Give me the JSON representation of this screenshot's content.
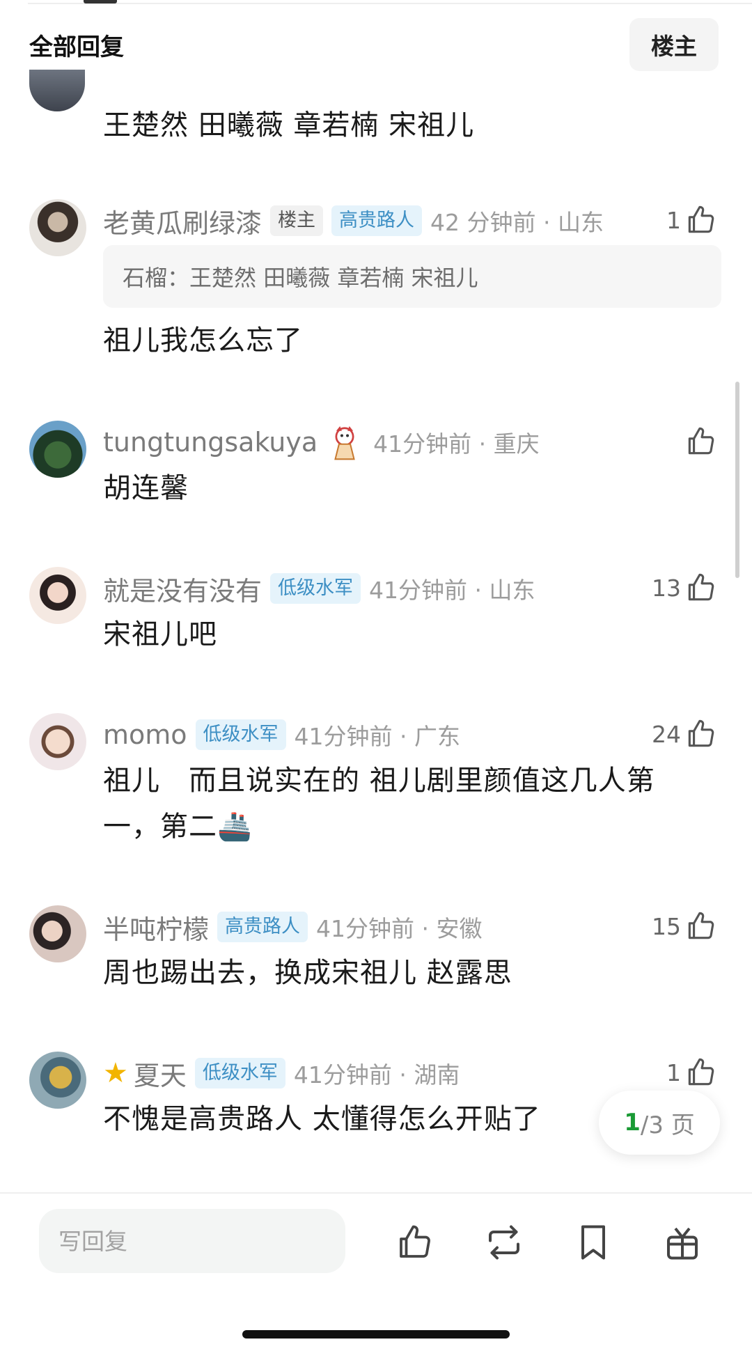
{
  "header": {
    "title": "全部回复",
    "filter_label": "楼主"
  },
  "partial_comment": {
    "text": "王楚然 田曦薇 章若楠 宋祖儿"
  },
  "comments": [
    {
      "username": "老黄瓜刷绿漆",
      "badges": [
        "楼主",
        "高贵路人"
      ],
      "time": "42 分钟前 · 山东",
      "likes": "1",
      "quote": "石榴：王楚然 田曦薇 章若楠 宋祖儿",
      "text": "祖儿我怎么忘了"
    },
    {
      "username": "tungtungsakuya",
      "badges": [],
      "time": "41分钟前 · 重庆",
      "likes": "",
      "text": "胡连馨"
    },
    {
      "username": "就是没有没有",
      "badges": [
        "低级水军"
      ],
      "time": "41分钟前 · 山东",
      "likes": "13",
      "text": "宋祖儿吧"
    },
    {
      "username": "momo",
      "badges": [
        "低级水军"
      ],
      "time": "41分钟前 · 广东",
      "likes": "24",
      "text": "祖儿　而且说实在的 祖儿剧里颜值这几人第一，第二🚢"
    },
    {
      "username": "半吨柠檬",
      "badges": [
        "高贵路人"
      ],
      "time": "41分钟前 · 安徽",
      "likes": "15",
      "text": "周也踢出去，换成宋祖儿 赵露思"
    },
    {
      "username": "夏天",
      "badges": [
        "低级水军"
      ],
      "time": "41分钟前 · 湖南",
      "likes": "1",
      "text": "不愧是高贵路人 太懂得怎么开贴了"
    }
  ],
  "pagination": {
    "current": "1",
    "rest": "/3 页"
  },
  "bottom_bar": {
    "reply_placeholder": "写回复"
  },
  "colors": {
    "accent_green": "#1a9a35",
    "badge_blue_bg": "#e5f3fb",
    "badge_blue_text": "#3d8fc4",
    "username_gray": "#7a7a7a"
  },
  "icons": [
    "thumbs-up-icon",
    "repost-icon",
    "bookmark-icon",
    "gift-icon",
    "star-icon",
    "ship-emoji",
    "sticker"
  ]
}
